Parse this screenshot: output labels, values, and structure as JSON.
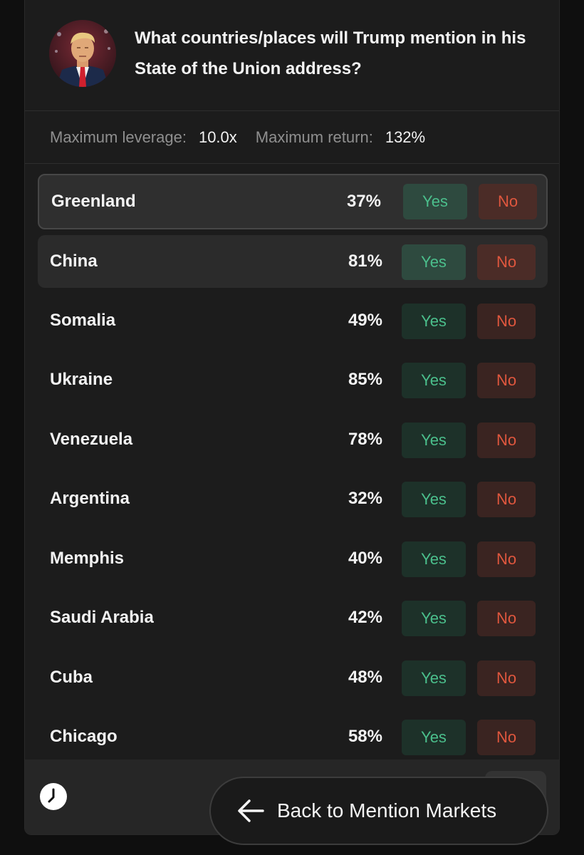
{
  "market": {
    "title": "What countries/places will Trump mention in his State of the Union address?",
    "avatar_icon": "trump-portrait"
  },
  "stats": {
    "leverage_label": "Maximum leverage:",
    "leverage_value": "10.0x",
    "return_label": "Maximum return:",
    "return_value": "132%"
  },
  "outcomes": [
    {
      "name": "Greenland",
      "pct": "37%",
      "yes": "Yes",
      "no": "No",
      "state": "selected"
    },
    {
      "name": "China",
      "pct": "81%",
      "yes": "Yes",
      "no": "No",
      "state": "hover"
    },
    {
      "name": "Somalia",
      "pct": "49%",
      "yes": "Yes",
      "no": "No",
      "state": "normal"
    },
    {
      "name": "Ukraine",
      "pct": "85%",
      "yes": "Yes",
      "no": "No",
      "state": "normal"
    },
    {
      "name": "Venezuela",
      "pct": "78%",
      "yes": "Yes",
      "no": "No",
      "state": "normal"
    },
    {
      "name": "Argentina",
      "pct": "32%",
      "yes": "Yes",
      "no": "No",
      "state": "normal"
    },
    {
      "name": "Memphis",
      "pct": "40%",
      "yes": "Yes",
      "no": "No",
      "state": "normal"
    },
    {
      "name": "Saudi Arabia",
      "pct": "42%",
      "yes": "Yes",
      "no": "No",
      "state": "normal"
    },
    {
      "name": "Cuba",
      "pct": "48%",
      "yes": "Yes",
      "no": "No",
      "state": "normal"
    },
    {
      "name": "Chicago",
      "pct": "58%",
      "yes": "Yes",
      "no": "No",
      "state": "normal"
    }
  ],
  "footer": {
    "clock_icon": "clock-icon",
    "back_label": "Back to Mention Markets",
    "back_icon": "arrow-left-icon"
  },
  "colors": {
    "yes_text": "#4bbf8c",
    "no_text": "#e0573e",
    "card_bg": "#1c1c1c"
  }
}
